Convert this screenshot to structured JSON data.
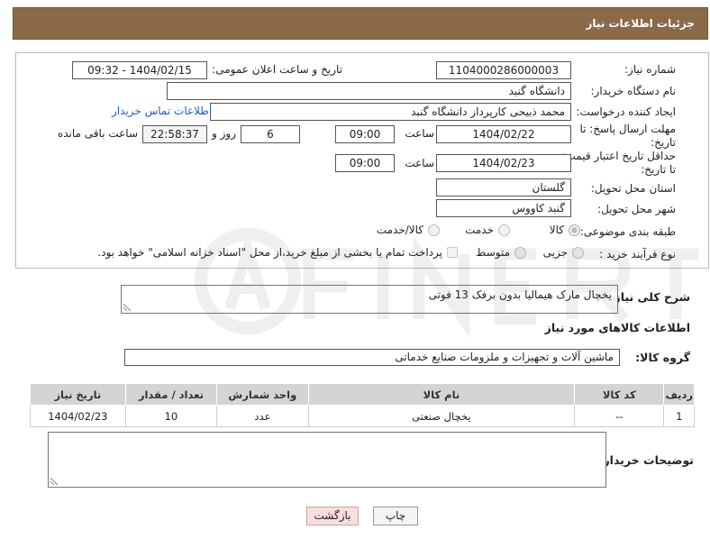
{
  "header": {
    "title": "جزئیات اطلاعات نیاز"
  },
  "form": {
    "need_number_label": "شماره نیاز:",
    "need_number": "1104000286000003",
    "announce_label": "تاریخ و ساعت اعلان عمومی:",
    "announce_value": "1404/02/15 - 09:32",
    "buyer_org_label": "نام دستگاه خریدار:",
    "buyer_org": "دانشگاه گنبد",
    "creator_label": "ایجاد کننده درخواست:",
    "creator": "محمد ذبیحی کارپرداز دانشگاه گنبد",
    "contact_link": "اطلاعات تماس خریدار",
    "reply_deadline_label_1": "مهلت ارسال پاسخ: تا",
    "reply_deadline_label_2": "تاریخ:",
    "reply_date": "1404/02/22",
    "time_label": "ساعت",
    "reply_time": "09:00",
    "days_value": "6",
    "days_label": "روز و",
    "remaining_time": "22:58:37",
    "remaining_label": "ساعت باقی مانده",
    "price_validity_label_1": "حداقل تاریخ اعتبار قیمت:",
    "price_validity_label_2": "تا تاریخ:",
    "price_date": "1404/02/23",
    "price_time": "09:00",
    "province_label": "استان محل تحویل:",
    "province": "گلستان",
    "city_label": "شهر محل تحویل:",
    "city": "گنبد کاووس",
    "category_label": "طبقه بندی موضوعی:",
    "category_options": [
      "کالا",
      "خدمت",
      "کالا/خدمت"
    ],
    "category_selected": "کالا",
    "process_label": "نوع فرآیند خرید :",
    "process_options": [
      "جزیی",
      "متوسط"
    ],
    "payment_note": "پرداخت تمام یا بخشی از مبلغ خرید،از محل \"اسناد خزانه اسلامی\" خواهد بود."
  },
  "description": {
    "label": "شرح کلی نیاز:",
    "value": "یخچال مارک هیمالیا بدون برفک 13 فوتی"
  },
  "goods_section": {
    "title": "اطلاعات کالاهای مورد نیاز",
    "group_label": "گروه کالا:",
    "group_value": "ماشین آلات و تجهیزات و ملزومات صنایع خدماتی"
  },
  "table": {
    "headers": [
      "ردیف",
      "کد کالا",
      "نام کالا",
      "واحد شمارش",
      "تعداد / مقدار",
      "تاریخ نیاز"
    ],
    "rows": [
      [
        "1",
        "--",
        "یخچال صنعتی",
        "عدد",
        "10",
        "1404/02/23"
      ]
    ]
  },
  "buyer_notes": {
    "label": "توضیحات خریدار:",
    "value": ""
  },
  "buttons": {
    "print": "چاپ",
    "back": "بازگشت"
  },
  "watermark": {
    "text": "AriaTender.neT"
  },
  "colors": {
    "header_bg": "#8b6a4a",
    "link": "#1f5fbf",
    "back_button_bg": "#f9dede",
    "table_header_bg": "#d4d4d4"
  }
}
